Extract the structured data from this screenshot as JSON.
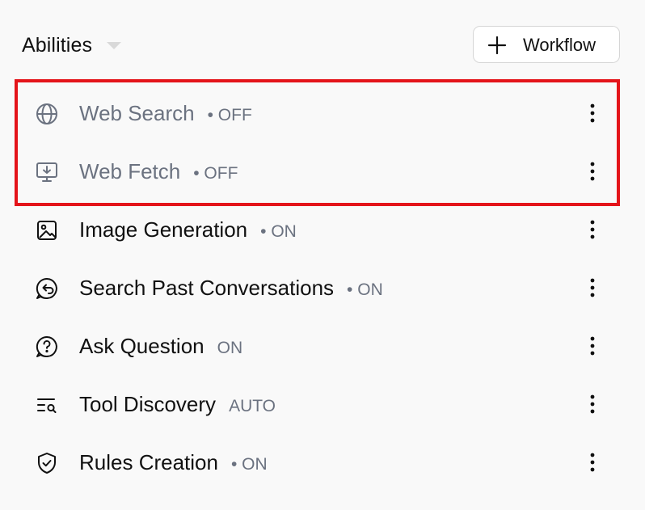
{
  "header": {
    "title": "Abilities",
    "workflow_button_label": "Workflow"
  },
  "abilities": [
    {
      "name": "Web Search",
      "status": "• OFF",
      "icon": "globe-icon",
      "enabled": false
    },
    {
      "name": "Web Fetch",
      "status": "• OFF",
      "icon": "monitor-download-icon",
      "enabled": false
    },
    {
      "name": "Image Generation",
      "status": "• ON",
      "icon": "image-icon",
      "enabled": true
    },
    {
      "name": "Search Past Conversations",
      "status": "• ON",
      "icon": "chat-history-icon",
      "enabled": true
    },
    {
      "name": "Ask Question",
      "status": "ON",
      "icon": "question-bubble-icon",
      "enabled": true
    },
    {
      "name": "Tool Discovery",
      "status": "AUTO",
      "icon": "list-search-icon",
      "enabled": true
    },
    {
      "name": "Rules Creation",
      "status": "• ON",
      "icon": "shield-check-icon",
      "enabled": true
    }
  ],
  "colors": {
    "highlight_border": "#e4141a",
    "muted_text": "#6b7280",
    "primary_text": "#111111"
  }
}
